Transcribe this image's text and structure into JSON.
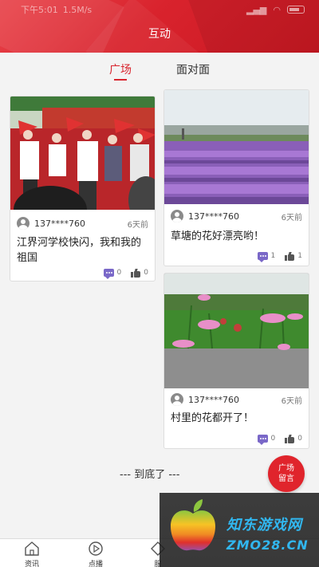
{
  "status_bar": {
    "time": "下午5:01",
    "speed": "1.5M/s"
  },
  "header": {
    "title": "互动"
  },
  "tabs": [
    {
      "label": "广场",
      "active": true
    },
    {
      "label": "面对面",
      "active": false
    }
  ],
  "posts": [
    {
      "username": "137****760",
      "time": "6天前",
      "text": "江界河学校快闪，我和我的祖国",
      "comments": "0",
      "likes": "0",
      "photo_icon": "crowd-with-flags-photo"
    },
    {
      "username": "137****760",
      "time": "6天前",
      "text": "草塘的花好漂亮哟！",
      "comments": "1",
      "likes": "1",
      "photo_icon": "lavender-field-photo"
    },
    {
      "username": "137****760",
      "time": "6天前",
      "text": "村里的花都开了！",
      "comments": "0",
      "likes": "0",
      "photo_icon": "pink-flowers-photo"
    }
  ],
  "end_text": "--- 到底了 ---",
  "fab": {
    "line1": "广场",
    "line2": "留言"
  },
  "bottom_nav": [
    {
      "label": "资讯",
      "icon": "home-icon"
    },
    {
      "label": "点播",
      "icon": "play-icon"
    },
    {
      "label": "服",
      "icon": "diamond-icon"
    }
  ],
  "watermark": {
    "line1": "知东游戏网",
    "line2": "ZMO28.CN"
  },
  "colors": {
    "brand_red": "#d8252e",
    "comment_purple": "#7a68c8"
  }
}
